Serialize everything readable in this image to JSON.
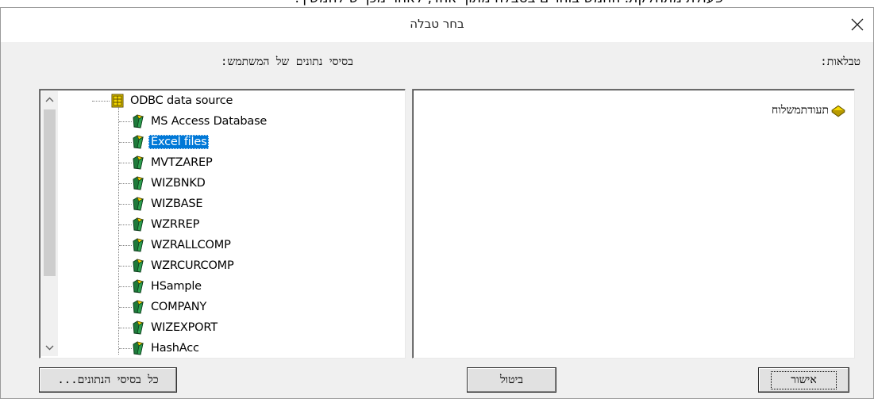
{
  "top_cut_text": "פעולת מתחלקת. החמש בוחרים בטבלה מתוך אחד, לאחר מכן יש להמשיך.",
  "dialog": {
    "title": "בחר טבלה",
    "left_label": "בסיסי נתונים של המשתמש:",
    "right_label": "טבלאות:"
  },
  "tree": {
    "root": "ODBC data source",
    "items": [
      {
        "label": "MS Access Database",
        "selected": false
      },
      {
        "label": "Excel files",
        "selected": true
      },
      {
        "label": "MVTZAREP",
        "selected": false
      },
      {
        "label": "WIZBNKD",
        "selected": false
      },
      {
        "label": "WIZBASE",
        "selected": false
      },
      {
        "label": "WZRREP",
        "selected": false
      },
      {
        "label": "WZRALLCOMP",
        "selected": false
      },
      {
        "label": "WZRCURCOMP",
        "selected": false
      },
      {
        "label": "HSample",
        "selected": false
      },
      {
        "label": "COMPANY",
        "selected": false
      },
      {
        "label": "WIZEXPORT",
        "selected": false
      },
      {
        "label": "HashAcc",
        "selected": false
      }
    ]
  },
  "tables": [
    {
      "label": "תעודתמשלוח"
    }
  ],
  "buttons": {
    "all_databases": "כל בסיסי הנתונים...",
    "cancel": "ביטול",
    "ok": "אישור"
  },
  "colors": {
    "selection": "#0078d7",
    "dialog_bg": "#f0f0f0",
    "icon_green": "#1e7a3a",
    "icon_yellow": "#f5d800"
  }
}
